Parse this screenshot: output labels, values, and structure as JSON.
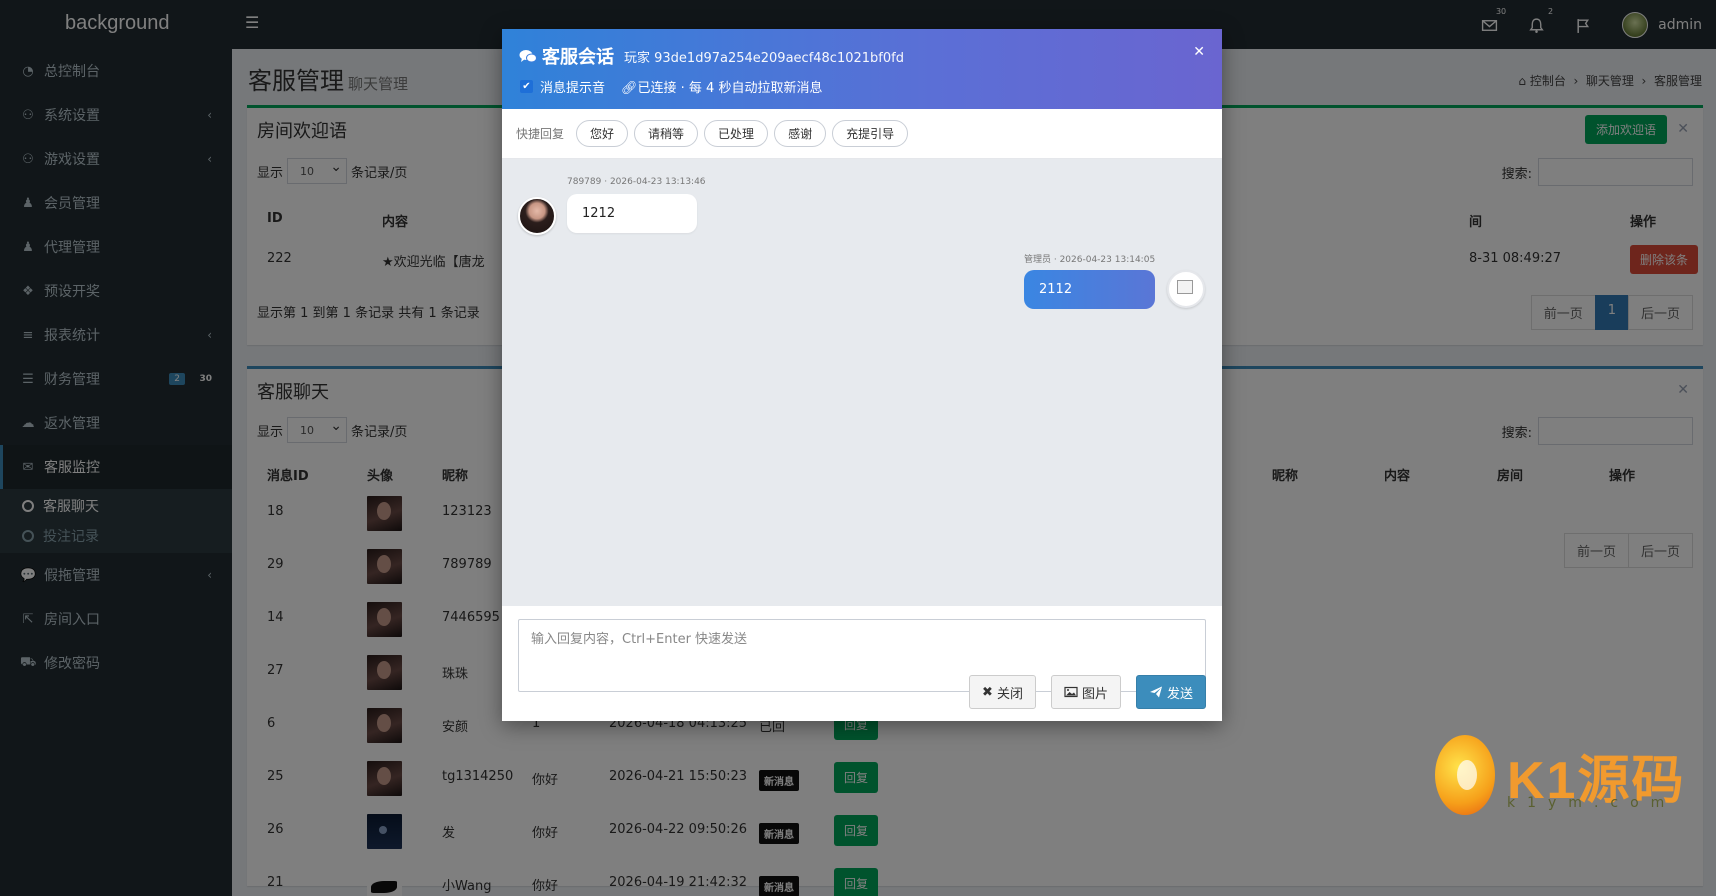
{
  "topbar": {
    "logo": "background",
    "user_name": "admin",
    "mail_badge": "30",
    "bell_badge": "2"
  },
  "sidebar": {
    "items": [
      {
        "icon": "dashboard-icon",
        "label": "总控制台"
      },
      {
        "icon": "gamepad-icon",
        "label": "系统设置"
      },
      {
        "icon": "gamepad-icon",
        "label": "游戏设置"
      },
      {
        "icon": "users-icon",
        "label": "会员管理"
      },
      {
        "icon": "users-icon",
        "label": "代理管理"
      },
      {
        "icon": "cubes-icon",
        "label": "预设开奖"
      },
      {
        "icon": "list-icon",
        "label": "报表统计"
      },
      {
        "icon": "database-icon",
        "label": "财务管理"
      },
      {
        "icon": "cloud-icon",
        "label": "返水管理"
      },
      {
        "icon": "chat-icon",
        "label": "客服监控"
      },
      {
        "icon": "comment-icon",
        "label": "假拖管理"
      },
      {
        "icon": "external-link-icon",
        "label": "房间入口"
      },
      {
        "icon": "cart-icon",
        "label": "修改密码"
      }
    ],
    "finance_badge": "2",
    "finance_badge2": "30",
    "sub_items": [
      "客服聊天",
      "投注记录"
    ]
  },
  "page": {
    "title": "客服管理",
    "subtitle": "聊天管理",
    "breadcrumb": [
      "控制台",
      "聊天管理",
      "客服管理"
    ]
  },
  "welcome_box": {
    "title": "房间欢迎语",
    "add_button": "添加欢迎语",
    "show_label": "显示",
    "page_size": "10",
    "per_page_label": "条记录/页",
    "search_label": "搜索:",
    "columns": [
      "ID",
      "内容",
      "间",
      "操作"
    ],
    "row": {
      "id": "222",
      "content": "★欢迎光临【唐龙",
      "time": "8-31 08:49:27",
      "action": "删除该条"
    },
    "info": "显示第 1 到第 1 条记录 共有 1 条记录",
    "prev": "前一页",
    "page": "1",
    "next": "后一页"
  },
  "chat_box": {
    "title": "客服聊天",
    "show_label": "显示",
    "page_size": "10",
    "per_page_label": "条记录/页",
    "search_label": "搜索:",
    "columns": [
      "消息ID",
      "头像",
      "昵称"
    ],
    "right_columns": [
      "昵称",
      "内容",
      "房间",
      "操作"
    ],
    "prev": "前一页",
    "next": "后一页",
    "rows": [
      {
        "id": "18",
        "nick": "123123",
        "content": "",
        "time": "",
        "status": "",
        "avatar": "portrait"
      },
      {
        "id": "29",
        "nick": "789789",
        "content": "",
        "time": "",
        "status": "",
        "avatar": "portrait"
      },
      {
        "id": "14",
        "nick": "7446595",
        "content": "",
        "time": "",
        "status": "",
        "avatar": "portrait"
      },
      {
        "id": "27",
        "nick": "珠珠",
        "content": "",
        "time": "",
        "status": "",
        "avatar": "portrait"
      },
      {
        "id": "6",
        "nick": "安颜",
        "content": "1",
        "time": "2026-04-18 04:13:25",
        "status": "已回",
        "avatar": "portrait"
      },
      {
        "id": "25",
        "nick": "tg1314250",
        "content": "你好",
        "time": "2026-04-21 15:50:23",
        "status": "新消息",
        "avatar": "portrait"
      },
      {
        "id": "26",
        "nick": "发",
        "content": "你好",
        "time": "2026-04-22 09:50:26",
        "status": "新消息",
        "avatar": "navy"
      },
      {
        "id": "21",
        "nick": "小Wang",
        "content": "你好",
        "time": "2026-04-19 21:42:32",
        "status": "新消息",
        "avatar": "bird"
      }
    ],
    "reply_label": "回复"
  },
  "modal": {
    "title": "客服会话",
    "player": "玩家 93de1d97a254e209aecf48c1021bf0fd",
    "sound_label": "消息提示音",
    "status": "已连接 · 每 4 秒自动拉取新消息",
    "quick_label": "快捷回复",
    "quick_replies": [
      "您好",
      "请稍等",
      "已处理",
      "感谢",
      "充提引导"
    ],
    "messages": [
      {
        "side": "left",
        "meta": "789789 · 2026-04-23 13:13:46",
        "text": "1212"
      },
      {
        "side": "right",
        "meta": "管理员 · 2026-04-23 13:14:05",
        "text": "2112"
      }
    ],
    "input_placeholder": "输入回复内容，Ctrl+Enter 快速发送",
    "close_label": "关闭",
    "image_label": "图片",
    "send_label": "发送"
  },
  "watermark": {
    "text": "K1源码",
    "sub": "k1ym.com"
  }
}
